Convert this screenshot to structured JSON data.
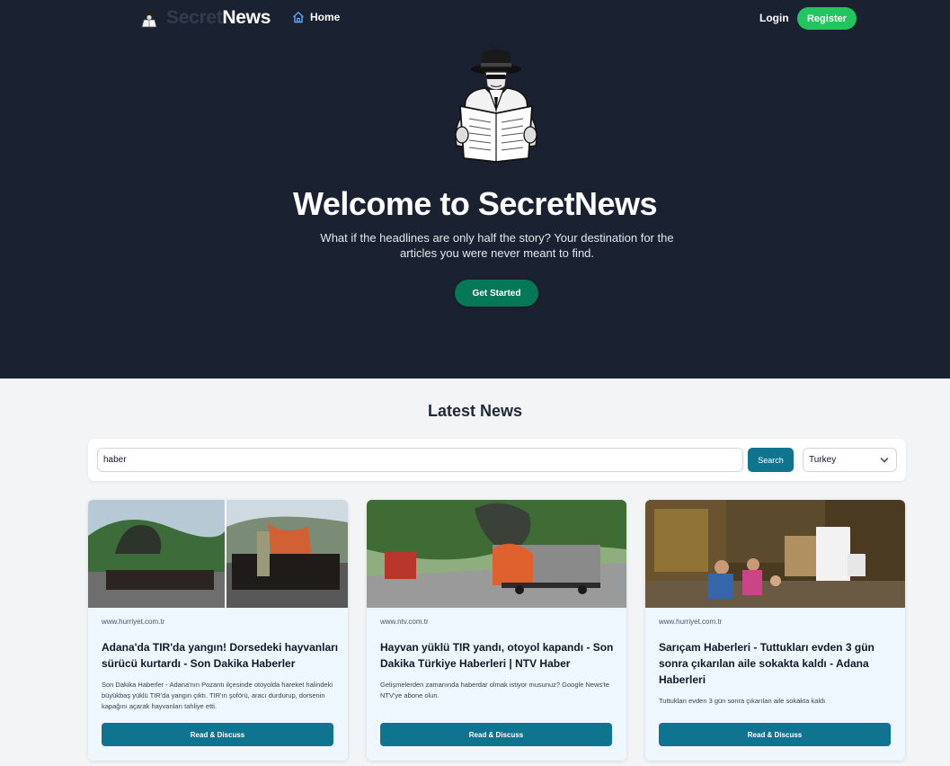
{
  "nav": {
    "brand_part1": "Secret",
    "brand_part2": "News",
    "home_label": "Home",
    "login_label": "Login",
    "register_label": "Register"
  },
  "hero": {
    "title": "Welcome to SecretNews",
    "subtitle": "What if the headlines are only half the story? Your destination for the articles you were never meant to find.",
    "cta_label": "Get Started"
  },
  "news": {
    "section_title": "Latest News",
    "search": {
      "value": "haber",
      "button_label": "Search",
      "country": "Turkey"
    },
    "cards": [
      {
        "source": "www.hurriyet.com.tr",
        "title": "Adana'da TIR'da yangın! Dorsedeki hayvanları sürücü kurtardı - Son Dakika Haberler",
        "description": "Son Dakika Haberler - Adana'nın Pozantı ilçesinde otoyolda hareket halindeki büyükbaş yüklü TIR'da yangın çıktı. TIR'ın şoförü, aracı durdurup, dorsenin kapağını açarak hayvanları tahliye etti.",
        "button_label": "Read & Discuss"
      },
      {
        "source": "www.ntv.com.tr",
        "title": "Hayvan yüklü TIR yandı, otoyol kapandı - Son Dakika Türkiye Haberleri | NTV Haber",
        "description": "Gelişmelerden zamanında haberdar olmak istiyor musunuz? Google News'te NTV'ye abone olun.",
        "button_label": "Read & Discuss"
      },
      {
        "source": "www.hurriyet.com.tr",
        "title": "Sarıçam Haberleri - Tuttukları evden 3 gün sonra çıkarılan aile sokakta kaldı - Adana Haberleri",
        "description": "Tuttukları evden 3 gün sonra çıkarılan aile sokakta kaldı",
        "button_label": "Read & Discuss"
      }
    ]
  },
  "colors": {
    "hero_bg": "#1a2131",
    "register_green": "#22c55e",
    "cta_green": "#047857",
    "primary_teal": "#0e7490",
    "card_body_bg": "#eef6fe"
  }
}
